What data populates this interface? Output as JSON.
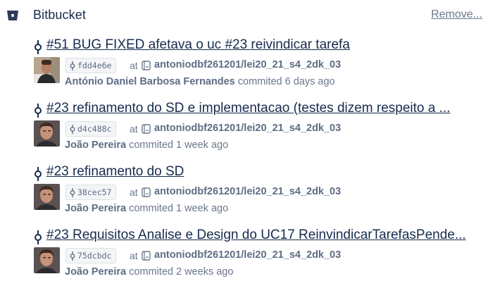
{
  "header": {
    "title": "Bitbucket",
    "remove_label": "Remove...",
    "logo_icon": "bitbucket-logo-icon",
    "brand_color": "#2f3a59"
  },
  "labels": {
    "at": "at",
    "commit_icon": "commit-icon",
    "repo_icon": "repo-icon"
  },
  "commits": [
    {
      "title": "#51 BUG FIXED afetava o uc #23 reivindicar tarefa",
      "hash": "fdd4e6e",
      "repo": "antoniodbf261201/lei20_21_s4_2dk_03",
      "author": "António Daniel Barbosa Fernandes",
      "time": "commited 6 days ago",
      "avatar": "avatar-antonio"
    },
    {
      "title": "#23 refinamento do SD e implementacao (testes dizem respeito a ...",
      "hash": "d4c488c",
      "repo": "antoniodbf261201/lei20_21_s4_2dk_03",
      "author": "João Pereira",
      "time": "commited 1 week ago",
      "avatar": "avatar-joao"
    },
    {
      "title": "#23 refinamento do SD",
      "hash": "38cec57",
      "repo": "antoniodbf261201/lei20_21_s4_2dk_03",
      "author": "João Pereira",
      "time": "commited 1 week ago",
      "avatar": "avatar-joao"
    },
    {
      "title": "#23 Requisitos Analise e Design do UC17 ReinvindicarTarefasPende...",
      "hash": "75dcbdc",
      "repo": "antoniodbf261201/lei20_21_s4_2dk_03",
      "author": "João Pereira",
      "time": "commited 2 weeks ago",
      "avatar": "avatar-joao"
    }
  ]
}
